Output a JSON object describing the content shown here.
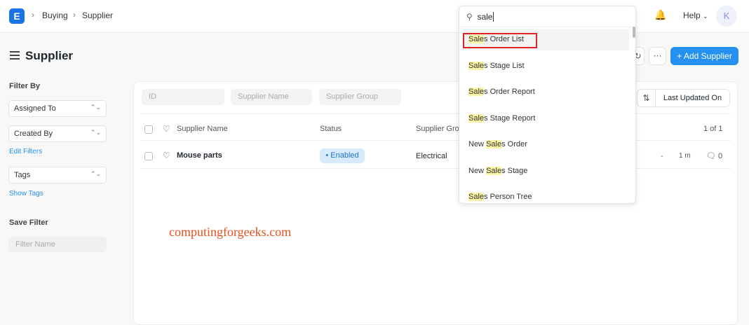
{
  "topbar": {
    "logo": "E",
    "breadcrumbs": [
      "Buying",
      "Supplier"
    ],
    "help": "Help",
    "avatar": "K"
  },
  "page": {
    "title": "Supplier",
    "add_button": "+ Add Supplier",
    "more": "···"
  },
  "sidebar": {
    "filter_by": "Filter By",
    "assigned_to": "Assigned To",
    "created_by": "Created By",
    "edit_filters": "Edit Filters",
    "tags": "Tags",
    "show_tags": "Show Tags",
    "save_filter": "Save Filter",
    "filter_name_placeholder": "Filter Name"
  },
  "filters": {
    "id": "ID",
    "supplier_name": "Supplier Name",
    "supplier_group": "Supplier Group",
    "sort": "Last Updated On"
  },
  "table": {
    "headers": {
      "name": "Supplier Name",
      "status": "Status",
      "group": "Supplier Gro"
    },
    "count": "1 of 1",
    "rows": [
      {
        "name": "Mouse parts",
        "status": "Enabled",
        "group": "Electrical",
        "dash": "-",
        "time": "1 m",
        "comments": "0"
      }
    ]
  },
  "search": {
    "query": "sale",
    "results": [
      {
        "pre": "",
        "hl": "Sale",
        "post": "s Order List"
      },
      {
        "pre": "",
        "hl": "Sale",
        "post": "s Stage List"
      },
      {
        "pre": "",
        "hl": "Sale",
        "post": "s Order Report"
      },
      {
        "pre": "",
        "hl": "Sale",
        "post": "s Stage Report"
      },
      {
        "pre": "New ",
        "hl": "Sale",
        "post": "s Order"
      },
      {
        "pre": "New ",
        "hl": "Sale",
        "post": "s Stage"
      },
      {
        "pre": "",
        "hl": "Sale",
        "post": "s Person Tree"
      }
    ]
  },
  "watermark": "computingforgeeks.com",
  "colors": {
    "primary": "#2490ef",
    "highlight": "#fbf4a4",
    "selection_box": "#e02424"
  }
}
